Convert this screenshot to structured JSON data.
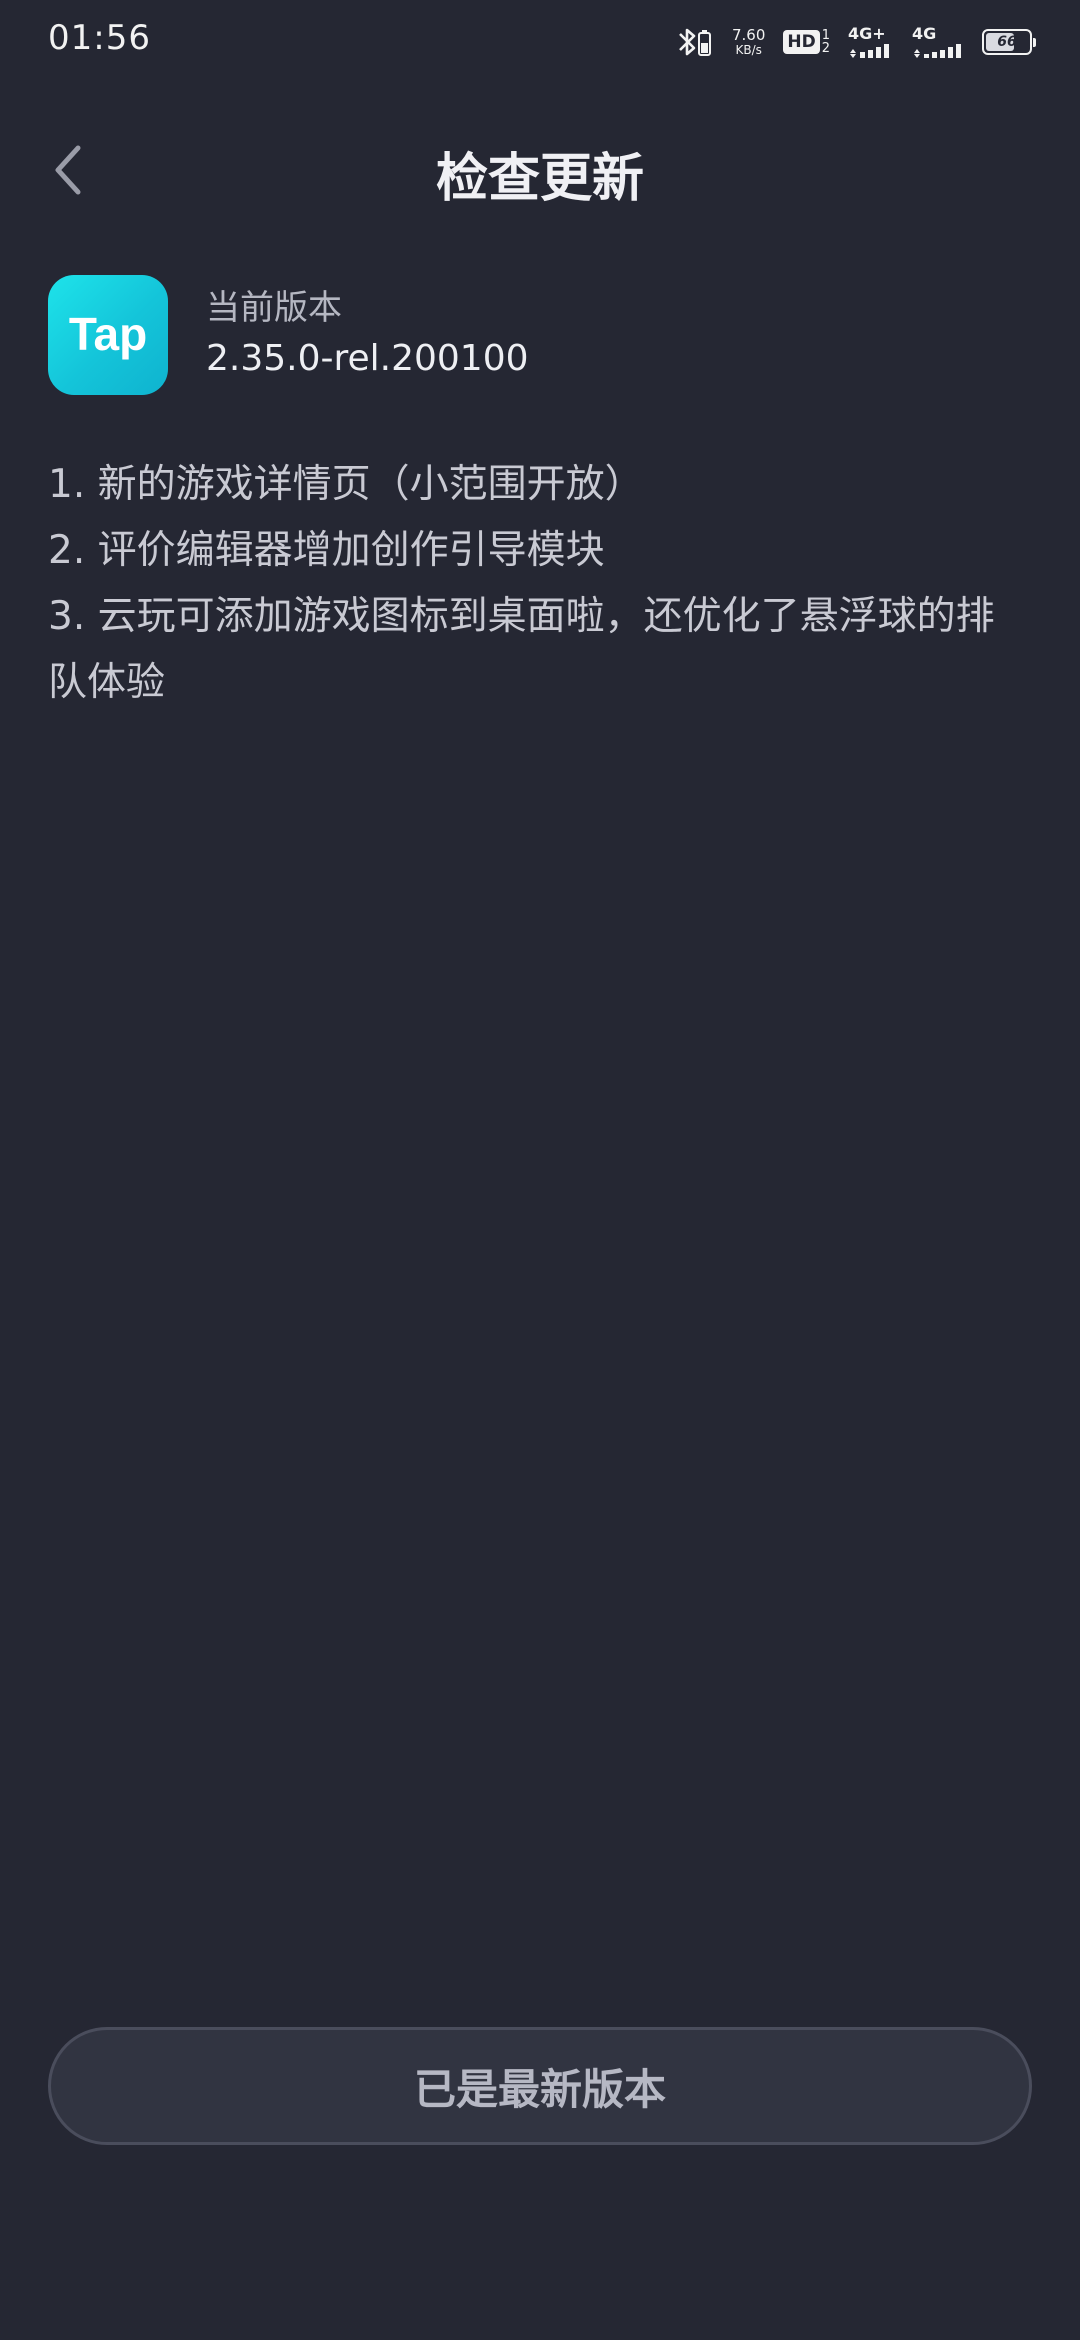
{
  "status_bar": {
    "time": "01:56",
    "net_speed_value": "7.60",
    "net_speed_unit": "KB/s",
    "hd_label": "HD",
    "hd_sim_top": "1",
    "hd_sim_bottom": "2",
    "signal1_label": "4G+",
    "signal2_label": "4G",
    "battery_level": "66",
    "battery_fraction": 0.66
  },
  "header": {
    "title": "检查更新"
  },
  "app": {
    "logo_text": "Tap",
    "version_label": "当前版本",
    "version_number": "2.35.0-rel.200100"
  },
  "changelog": [
    "1. 新的游戏详情页（小范围开放）",
    "2. 评价编辑器增加创作引导模块",
    "3. 云玩可添加游戏图标到桌面啦，还优化了悬浮球的排队体验"
  ],
  "action_button": {
    "label": "已是最新版本"
  },
  "colors": {
    "background": "#252733",
    "logo_accent": "#14c4d9",
    "button_border": "#4a4d5c"
  }
}
